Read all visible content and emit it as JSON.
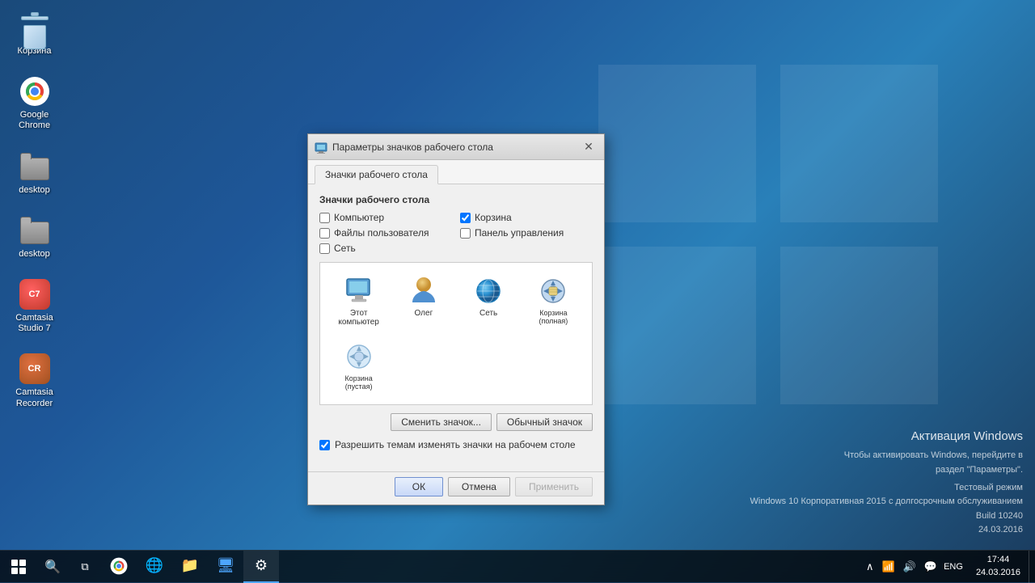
{
  "desktop": {
    "icons": [
      {
        "id": "recyclebin",
        "label": "Корзина",
        "type": "recyclebin"
      },
      {
        "id": "chrome",
        "label": "Google Chrome",
        "type": "chrome"
      },
      {
        "id": "desktop1",
        "label": "desktop",
        "type": "folder"
      },
      {
        "id": "desktop2",
        "label": "desktop",
        "type": "folder"
      },
      {
        "id": "camtasia7",
        "label": "Camtasia Studio 7",
        "type": "camtasia"
      },
      {
        "id": "camtasiaRec",
        "label": "Camtasia Recorder",
        "type": "camtasia2"
      }
    ]
  },
  "dialog": {
    "title": "Параметры значков рабочего стола",
    "tabs": [
      {
        "id": "desktop-icons-tab",
        "label": "Значки рабочего стола",
        "active": true
      }
    ],
    "section_title": "Значки рабочего стола",
    "checkboxes": [
      {
        "id": "computer",
        "label": "Компьютер",
        "checked": false
      },
      {
        "id": "korzina",
        "label": "Корзина",
        "checked": true
      },
      {
        "id": "files",
        "label": "Файлы пользователя",
        "checked": false
      },
      {
        "id": "panel",
        "label": "Панель управления",
        "checked": false
      },
      {
        "id": "network",
        "label": "Сеть",
        "checked": false
      }
    ],
    "icons": [
      {
        "id": "computer-icon",
        "label": "Этот компьютер",
        "type": "computer",
        "selected": false
      },
      {
        "id": "user-icon",
        "label": "Олег",
        "type": "person",
        "selected": false
      },
      {
        "id": "network-icon",
        "label": "Сеть",
        "type": "network",
        "selected": false
      },
      {
        "id": "recycle-full-icon",
        "label": "Корзина (полная)",
        "type": "recycle-full",
        "selected": false
      },
      {
        "id": "recycle-empty-icon",
        "label": "Корзина (пустая)",
        "type": "recycle-empty",
        "selected": false
      }
    ],
    "btn_change": "Сменить значок...",
    "btn_default": "Обычный значок",
    "theme_checkbox_label": "Разрешить темам изменять значки на рабочем столе",
    "theme_checkbox_checked": true,
    "btn_ok": "ОК",
    "btn_cancel": "Отмена",
    "btn_apply": "Применить"
  },
  "taskbar": {
    "clock_time": "17:44",
    "clock_date": "24.03.2016",
    "lang": "ENG"
  },
  "activation": {
    "title": "Активация Windows",
    "line1": "Чтобы активировать Windows, перейдите в",
    "line2": "раздел \"Параметры\".",
    "line3": "Тестовый режим",
    "line4": "Windows 10 Корпоративная 2015 с долгосрочным обслуживанием",
    "line5": "Build 10240",
    "line6": "24.03.2016"
  }
}
